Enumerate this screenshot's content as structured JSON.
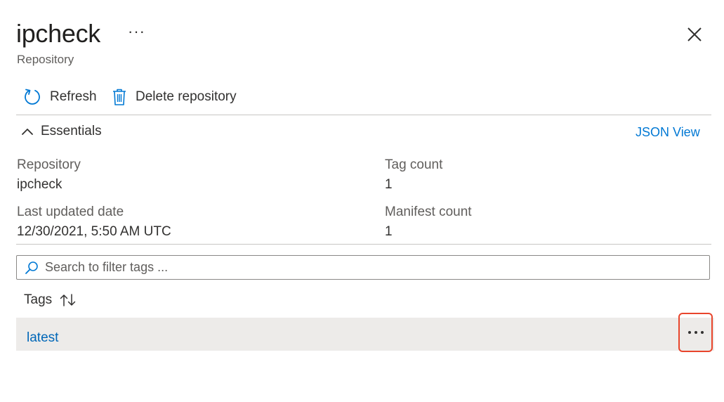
{
  "header": {
    "title": "ipcheck",
    "more_label": "···",
    "subtitle": "Repository",
    "close_icon": "close-icon"
  },
  "toolbar": {
    "refresh_label": "Refresh",
    "delete_label": "Delete repository"
  },
  "essentials": {
    "label": "Essentials",
    "json_view_label": "JSON View",
    "fields": {
      "repository": {
        "label": "Repository",
        "value": "ipcheck"
      },
      "tag_count": {
        "label": "Tag count",
        "value": "1"
      },
      "last_updated": {
        "label": "Last updated date",
        "value": "12/30/2021, 5:50 AM UTC"
      },
      "manifest_count": {
        "label": "Manifest count",
        "value": "1"
      }
    }
  },
  "search": {
    "placeholder": "Search to filter tags ...",
    "value": ""
  },
  "tags": {
    "column_header": "Tags",
    "rows": [
      {
        "name": "latest"
      }
    ]
  },
  "colors": {
    "accent": "#0078d4",
    "link": "#0067b8",
    "highlight": "#e8452c",
    "row_bg": "#edebe9"
  }
}
